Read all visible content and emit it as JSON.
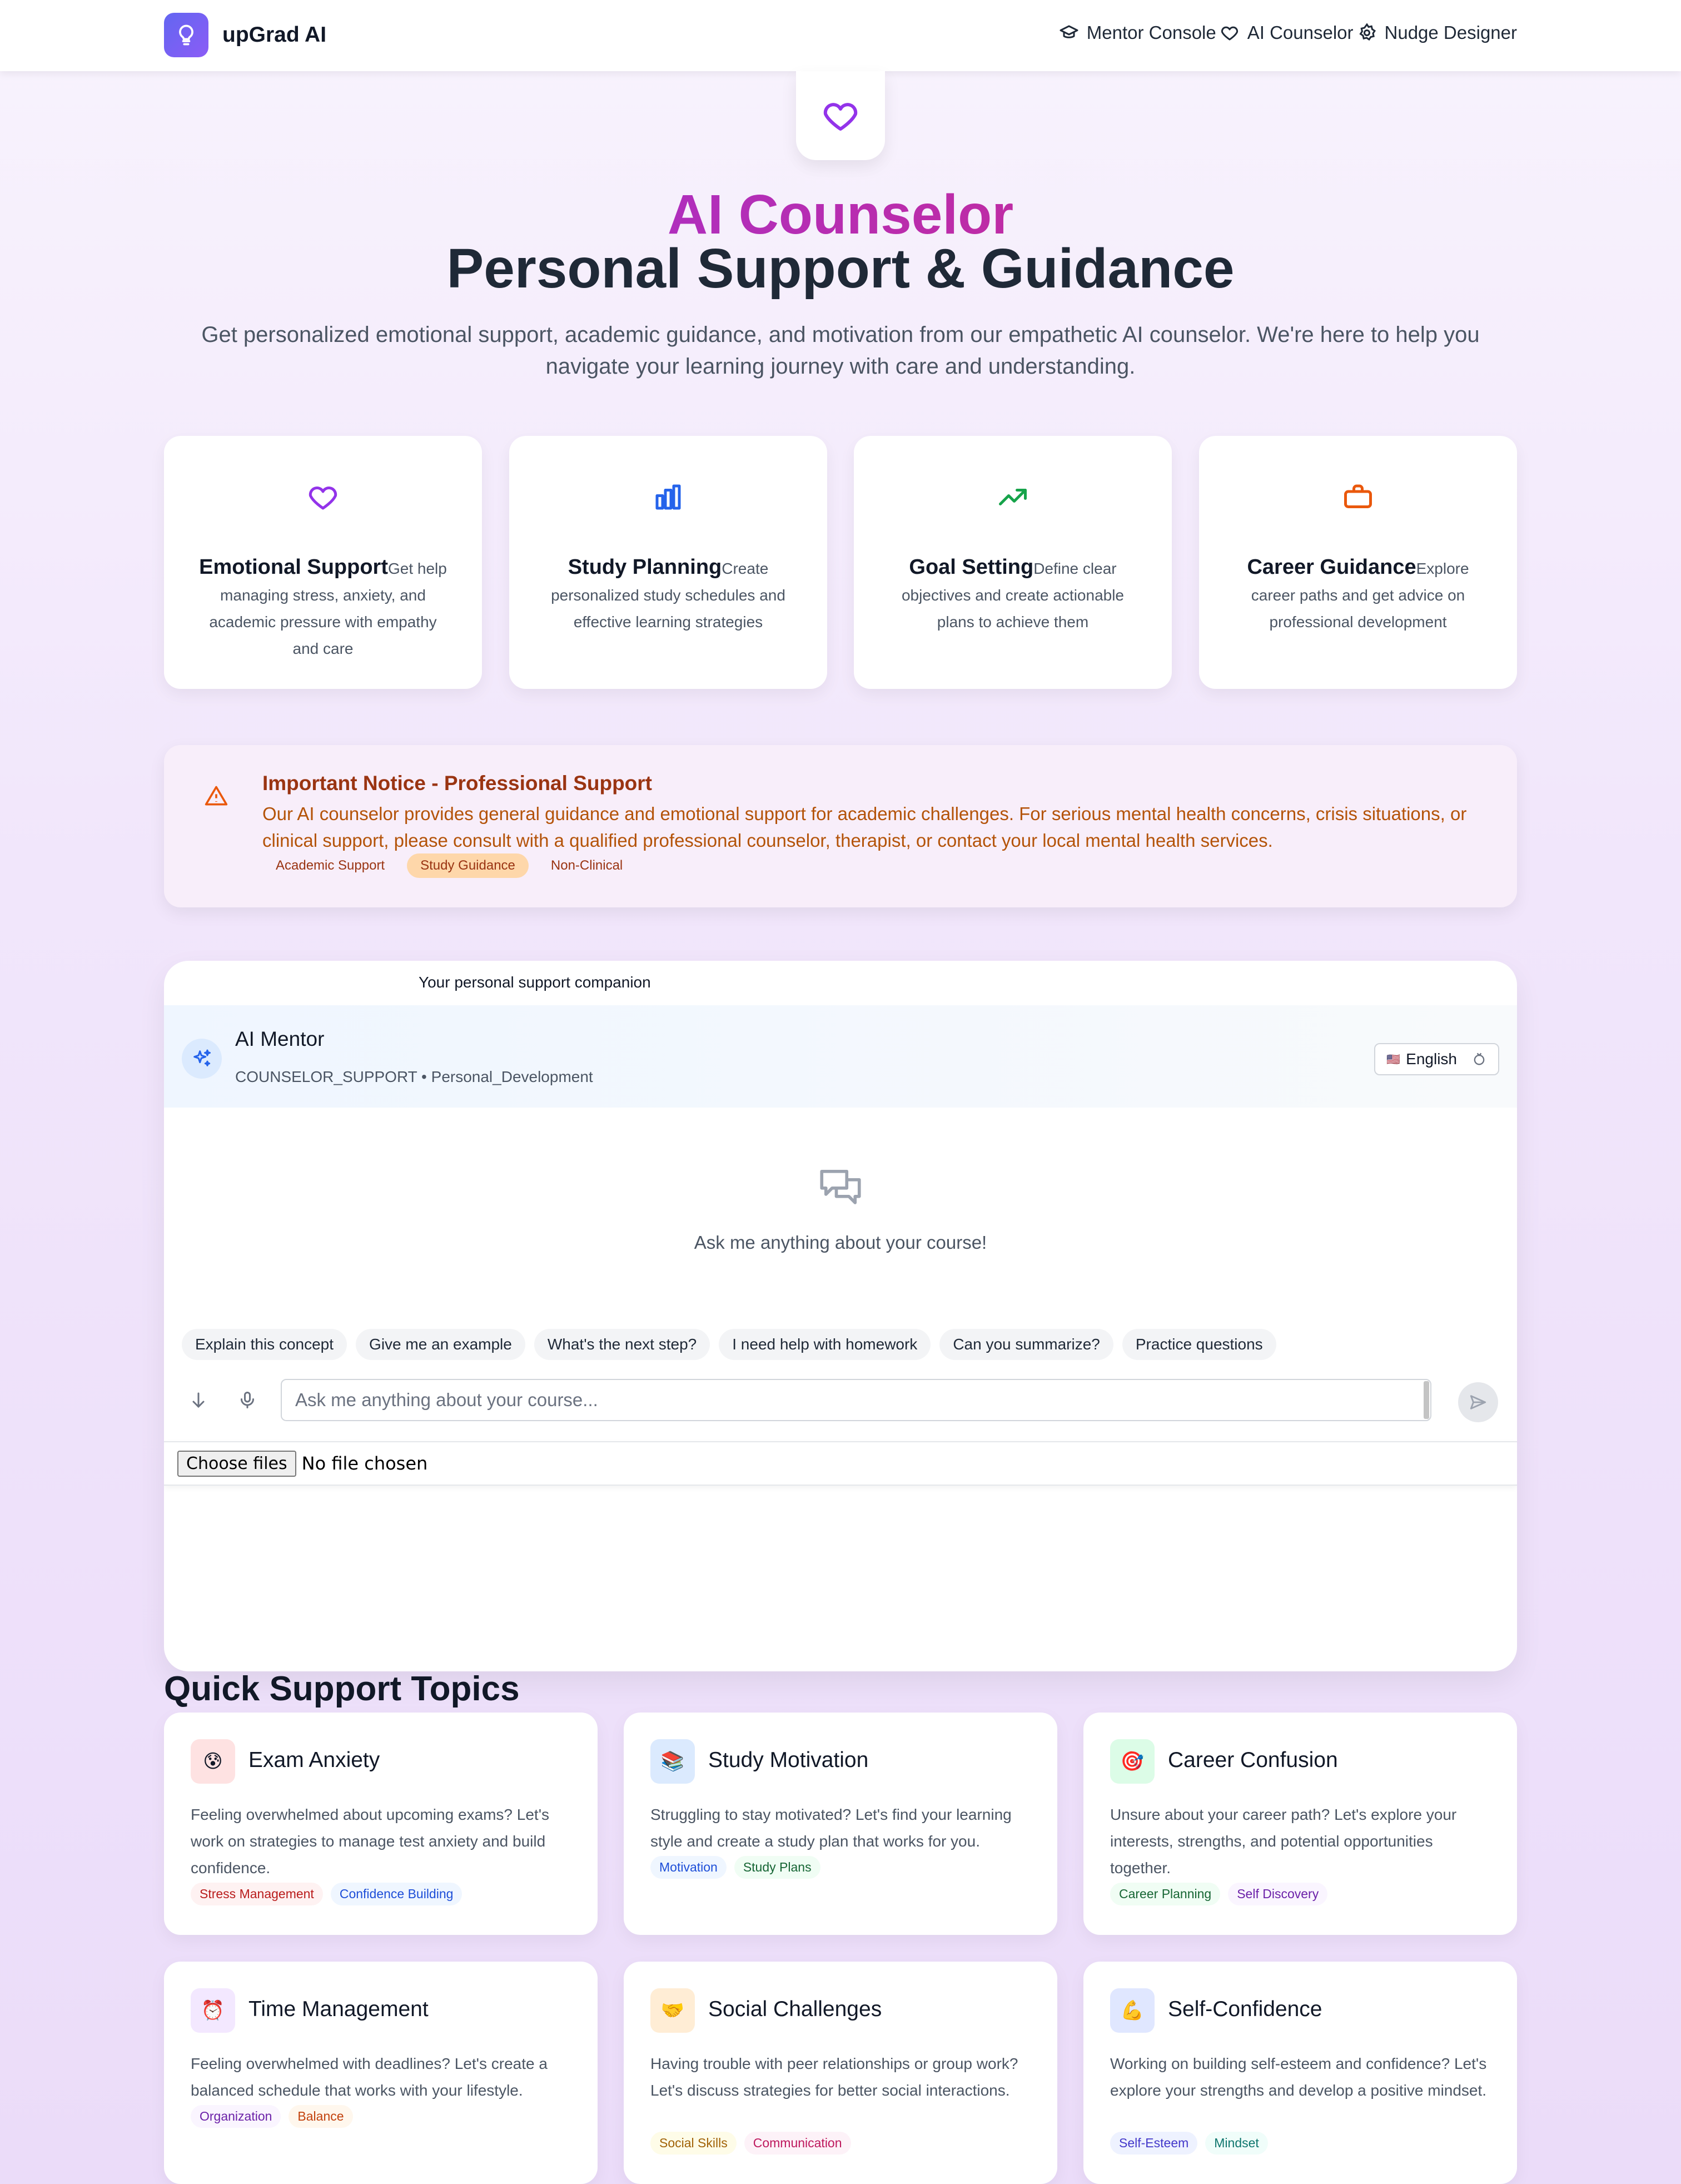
{
  "nav": {
    "brand": "upGrad AI",
    "links": [
      {
        "label": "Mentor Console",
        "icon": "graduation-cap-icon"
      },
      {
        "label": "AI Counselor",
        "icon": "heart-icon"
      },
      {
        "label": "Nudge Designer",
        "icon": "gear-icon"
      }
    ]
  },
  "hero": {
    "title_line1": "AI Counselor",
    "title_line2": "Personal Support & Guidance",
    "subtitle": "Get personalized emotional support, academic guidance, and motivation from our empathetic AI counselor. We're here to help you navigate your learning journey with care and understanding."
  },
  "features": [
    {
      "title": "Emotional Support",
      "desc": "Get help managing stress, anxiety, and academic pressure with empathy and care",
      "icon": "heart-icon",
      "color": "#9333ea"
    },
    {
      "title": "Study Planning",
      "desc": "Create personalized study schedules and effective learning strategies",
      "icon": "chart-icon",
      "color": "#2563eb"
    },
    {
      "title": "Goal Setting",
      "desc": "Define clear objectives and create actionable plans to achieve them",
      "icon": "trending-up-icon",
      "color": "#16a34a"
    },
    {
      "title": "Career Guidance",
      "desc": "Explore career paths and get advice on professional development",
      "icon": "briefcase-icon",
      "color": "#ea580c"
    }
  ],
  "notice": {
    "title": "Important Notice - Professional Support",
    "text": "Our AI counselor provides general guidance and emotional support for academic challenges. For serious mental health concerns, crisis situations, or clinical support, please consult with a qualified professional counselor, therapist, or contact your local mental health services.",
    "badges": [
      "Academic Support",
      "Study Guidance",
      "Non-Clinical"
    ]
  },
  "chat": {
    "companion_label": "Your personal support companion",
    "mentor_name": "AI Mentor",
    "mentor_sub": "COUNSELOR_SUPPORT • Personal_Development",
    "language": "English",
    "flag": "🇺🇸",
    "empty_text": "Ask me anything about your course!",
    "suggestions": [
      "Explain this concept",
      "Give me an example",
      "What's the next step?",
      "I need help with homework",
      "Can you summarize?",
      "Practice questions"
    ],
    "input_placeholder": "Ask me anything about your course...",
    "file_button": "Choose files",
    "file_status": "No file chosen"
  },
  "quick_support": {
    "title": "Quick Support Topics",
    "topics": [
      {
        "name": "Exam Anxiety",
        "emoji": "😰",
        "icon_bg": "#fee2e2",
        "desc": "Feeling overwhelmed about upcoming exams? Let's work on strategies to manage test anxiety and build confidence.",
        "tags": [
          {
            "label": "Stress Management",
            "bg": "#fef2f2",
            "fg": "#b91c1c"
          },
          {
            "label": "Confidence Building",
            "bg": "#eff6ff",
            "fg": "#1d4ed8"
          }
        ]
      },
      {
        "name": "Study Motivation",
        "emoji": "📚",
        "icon_bg": "#dbeafe",
        "desc": "Struggling to stay motivated? Let's find your learning style and create a study plan that works for you.",
        "tags": [
          {
            "label": "Motivation",
            "bg": "#eff6ff",
            "fg": "#1d4ed8"
          },
          {
            "label": "Study Plans",
            "bg": "#f0fdf4",
            "fg": "#166534"
          }
        ]
      },
      {
        "name": "Career Confusion",
        "emoji": "🎯",
        "icon_bg": "#dcfce7",
        "desc": "Unsure about your career path? Let's explore your interests, strengths, and potential opportunities together.",
        "tags": [
          {
            "label": "Career Planning",
            "bg": "#f0fdf4",
            "fg": "#166534"
          },
          {
            "label": "Self Discovery",
            "bg": "#faf5ff",
            "fg": "#6b21a8"
          }
        ]
      },
      {
        "name": "Time Management",
        "emoji": "⏰",
        "icon_bg": "#f3e8ff",
        "desc": "Feeling overwhelmed with deadlines? Let's create a balanced schedule that works with your lifestyle.",
        "tags": [
          {
            "label": "Organization",
            "bg": "#faf5ff",
            "fg": "#6b21a8"
          },
          {
            "label": "Balance",
            "bg": "#fff7ed",
            "fg": "#c2410c"
          }
        ]
      },
      {
        "name": "Social Challenges",
        "emoji": "🤝",
        "icon_bg": "#ffedd5",
        "desc": "Having trouble with peer relationships or group work? Let's discuss strategies for better social interactions.",
        "tags": [
          {
            "label": "Social Skills",
            "bg": "#fefce8",
            "fg": "#a16207"
          },
          {
            "label": "Communication",
            "bg": "#fdf2f8",
            "fg": "#be185d"
          }
        ]
      },
      {
        "name": "Self-Confidence",
        "emoji": "💪",
        "icon_bg": "#e0e7ff",
        "desc": "Working on building self-esteem and confidence? Let's explore your strengths and develop a positive mindset.",
        "tags": [
          {
            "label": "Self-Esteem",
            "bg": "#eef2ff",
            "fg": "#4338ca"
          },
          {
            "label": "Mindset",
            "bg": "#f0fdfa",
            "fg": "#0f766e"
          }
        ]
      }
    ]
  }
}
